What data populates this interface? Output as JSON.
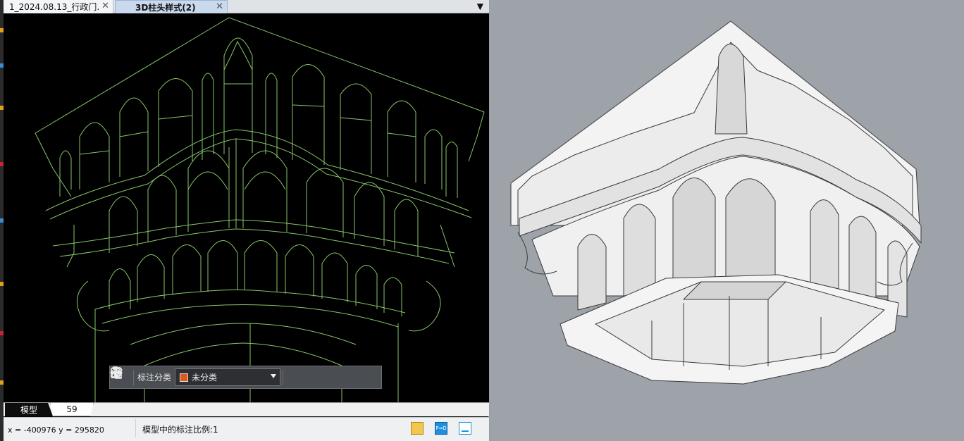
{
  "window": {
    "tabs": [
      {
        "label": "1_2024.08.13_行政门…",
        "active": false
      },
      {
        "label": "3D柱头样式(2)",
        "active": true
      }
    ]
  },
  "annotation_toolbar": {
    "label": "标注分类",
    "selected": "未分类",
    "swatch_color": "#e2571e"
  },
  "layout_tabs": [
    "模型",
    "59"
  ],
  "status": {
    "coords": "x = -400976  y = 295820",
    "scale": "模型中的标注比例:1"
  },
  "colors": {
    "wire": "#86c66a",
    "viewport_bg": "#000000",
    "render_bg": "#9da3a9",
    "render_fill": "#f2f2f2"
  }
}
